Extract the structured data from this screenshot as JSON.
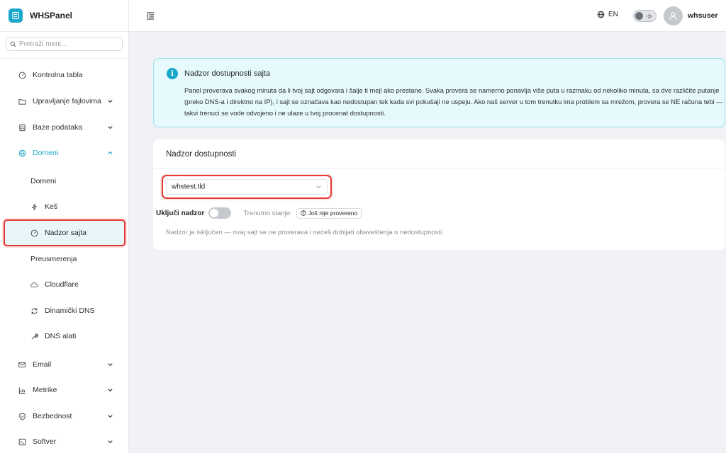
{
  "brand": {
    "name": "WHSPanel"
  },
  "search": {
    "placeholder": "Pretraži meni..."
  },
  "sidebar": {
    "items": [
      {
        "label": "Kontrolna tabla"
      },
      {
        "label": "Upravljanje fajlovima"
      },
      {
        "label": "Baze podataka"
      },
      {
        "label": "Domeni"
      },
      {
        "label": "Email"
      },
      {
        "label": "Metrike"
      },
      {
        "label": "Bezbednost"
      },
      {
        "label": "Softver"
      }
    ],
    "sub_items": [
      {
        "label": "Domeni"
      },
      {
        "label": "Keš"
      },
      {
        "label": "Nadzor sajta"
      },
      {
        "label": "Preusmerenja"
      },
      {
        "label": "Cloudflare"
      },
      {
        "label": "Dinamički DNS"
      },
      {
        "label": "DNS alati"
      }
    ]
  },
  "topbar": {
    "language": "EN",
    "username": "whsuser"
  },
  "info": {
    "title": "Nadzor dostupnosti sajta",
    "text": "Panel proverava svakog minuta da li tvoj sajt odgovara i šalje ti mejl ako prestane. Svaka provera se namerno ponavlja više puta u razmaku od nekoliko minuta, sa dve različite putanje (preko DNS-a i direktno na IP), i sajt se označava kao nedostupan tek kada svi pokušaji ne uspeju. Ako naš server u tom trenutku ima problem sa mrežom, provera se NE računa tebi — takvi trenuci se vode odvojeno i ne ulaze u tvoj procenat dostupnosti."
  },
  "card": {
    "title": "Nadzor dostupnosti",
    "domain_value": "whstest.tld",
    "toggle_label": "Uključi nadzor",
    "state_label": "Trenutno stanje:",
    "state_badge": "Još nije provereno",
    "hint": "Nadzor je isključen — ovaj sajt se ne proverava i nećeš dobijati obaveštenja o nedostupnosti."
  },
  "colors": {
    "accent": "#1ba7c9",
    "highlight": "#e53935",
    "info_bg": "#e6fafd"
  }
}
